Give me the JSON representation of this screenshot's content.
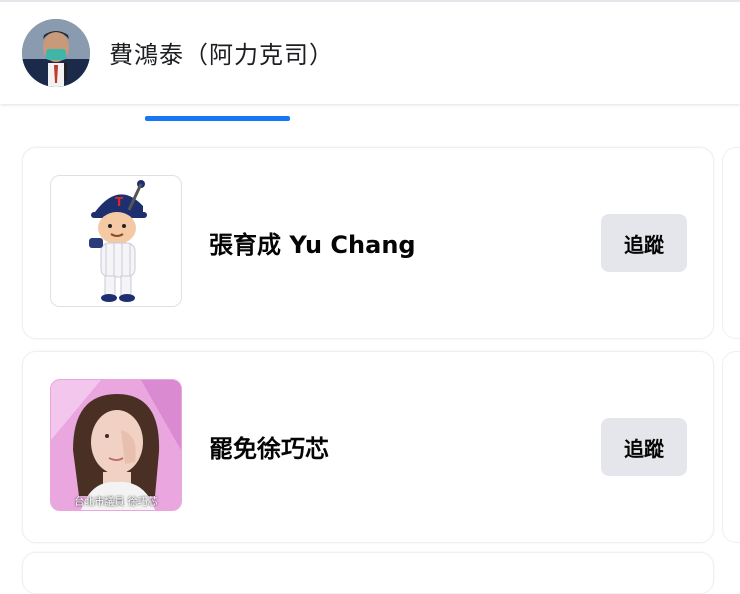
{
  "header": {
    "title": "費鴻泰（阿力克司）",
    "avatar_icon": "profile-photo"
  },
  "accent_color": "#1877f2",
  "suggestions": [
    {
      "name": "張育成 Yu Chang",
      "image_icon": "cartoon-baseball-player",
      "follow_label": "追蹤"
    },
    {
      "name": "罷免徐巧芯",
      "image_icon": "photo-woman-crying",
      "caption": "台北市議員 徐巧芯",
      "follow_label": "追蹤"
    }
  ]
}
